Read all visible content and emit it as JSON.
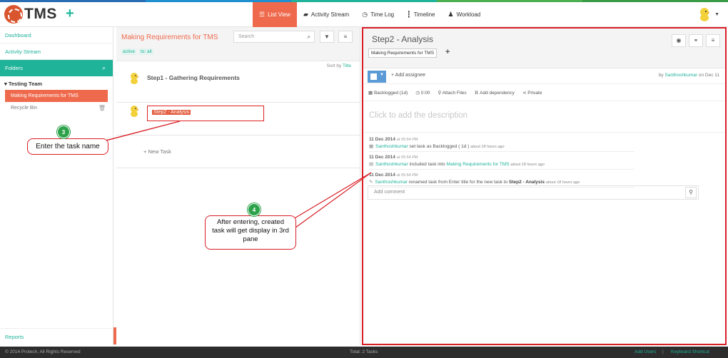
{
  "colors": {
    "accent": "#ef6a4d",
    "teal": "#1fb39a",
    "annotation": "#d81f26",
    "step_green": "#2ca24a"
  },
  "header": {
    "app_name": "TMS",
    "nav": [
      {
        "label": "List View",
        "icon": "list-icon",
        "active": true
      },
      {
        "label": "Activity Stream",
        "icon": "comment-icon"
      },
      {
        "label": "Time Log",
        "icon": "clock-icon"
      },
      {
        "label": "Timeline",
        "icon": "timeline-icon"
      },
      {
        "label": "Workload",
        "icon": "user-icon"
      }
    ]
  },
  "sidebar": {
    "dashboard": "Dashboard",
    "activity_stream": "Activity Stream",
    "folders": "Folders",
    "team": "Testing Team",
    "folder_item": "Making Requirements for TMS",
    "recycle": "Recycle Bin",
    "reports": "Reports"
  },
  "middle": {
    "title": "Making Requirements for TMS",
    "filters": [
      "active",
      "to: all"
    ],
    "search_placeholder": "Search",
    "sort_label": "Sort by",
    "sort_value": "Title",
    "task1": "Step1 - Gathering Requirements",
    "task2_input": "Step2 - Analysis",
    "new_task": "New Task"
  },
  "right": {
    "title": "Step2 - Analysis",
    "folder_tag": "Making Requirements for TMS",
    "add_assignee": "Add assignee",
    "by_prefix": "by",
    "by_user": "Santhoshkumar",
    "by_date": "on Dec 11",
    "props": {
      "status": "Backlogged (1d)",
      "time": "0:00",
      "attach": "Attach Files",
      "dependency": "Add dependency",
      "private": "Private"
    },
    "description_placeholder": "Click to add the description",
    "activity": [
      {
        "date": "11 Dec 2014",
        "time": "at 05:54 PM",
        "user": "Santhoshkumar",
        "text": "set task as Backlogged ( 1d )",
        "ago": "about 18 hours ago"
      },
      {
        "date": "11 Dec 2014",
        "time": "at 05:54 PM",
        "user": "Santhoshkumar",
        "text": "included task into",
        "link": "Making Requirements for TMS",
        "ago": "about 18 hours ago"
      },
      {
        "date": "11 Dec 2014",
        "time": "at 05:54 PM",
        "user": "Santhoshkumar",
        "text": "renamed task from Enter title for the new task to",
        "bold": "Step2 - Analysis",
        "ago": "about 18 hours ago"
      }
    ],
    "comment_placeholder": "Add comment"
  },
  "annotations": {
    "step3_num": "3",
    "step3_text": "Enter the task name",
    "step4_num": "4",
    "step4_text": "After entering, created task will get display in 3rd pane"
  },
  "footer": {
    "copyright": "© 2014 Protech, All Rights Reserved",
    "total": "Total: 2 Tasks",
    "add_users": "Add Users",
    "separator": "|",
    "shortcut": "Keyboard Shortcut"
  }
}
